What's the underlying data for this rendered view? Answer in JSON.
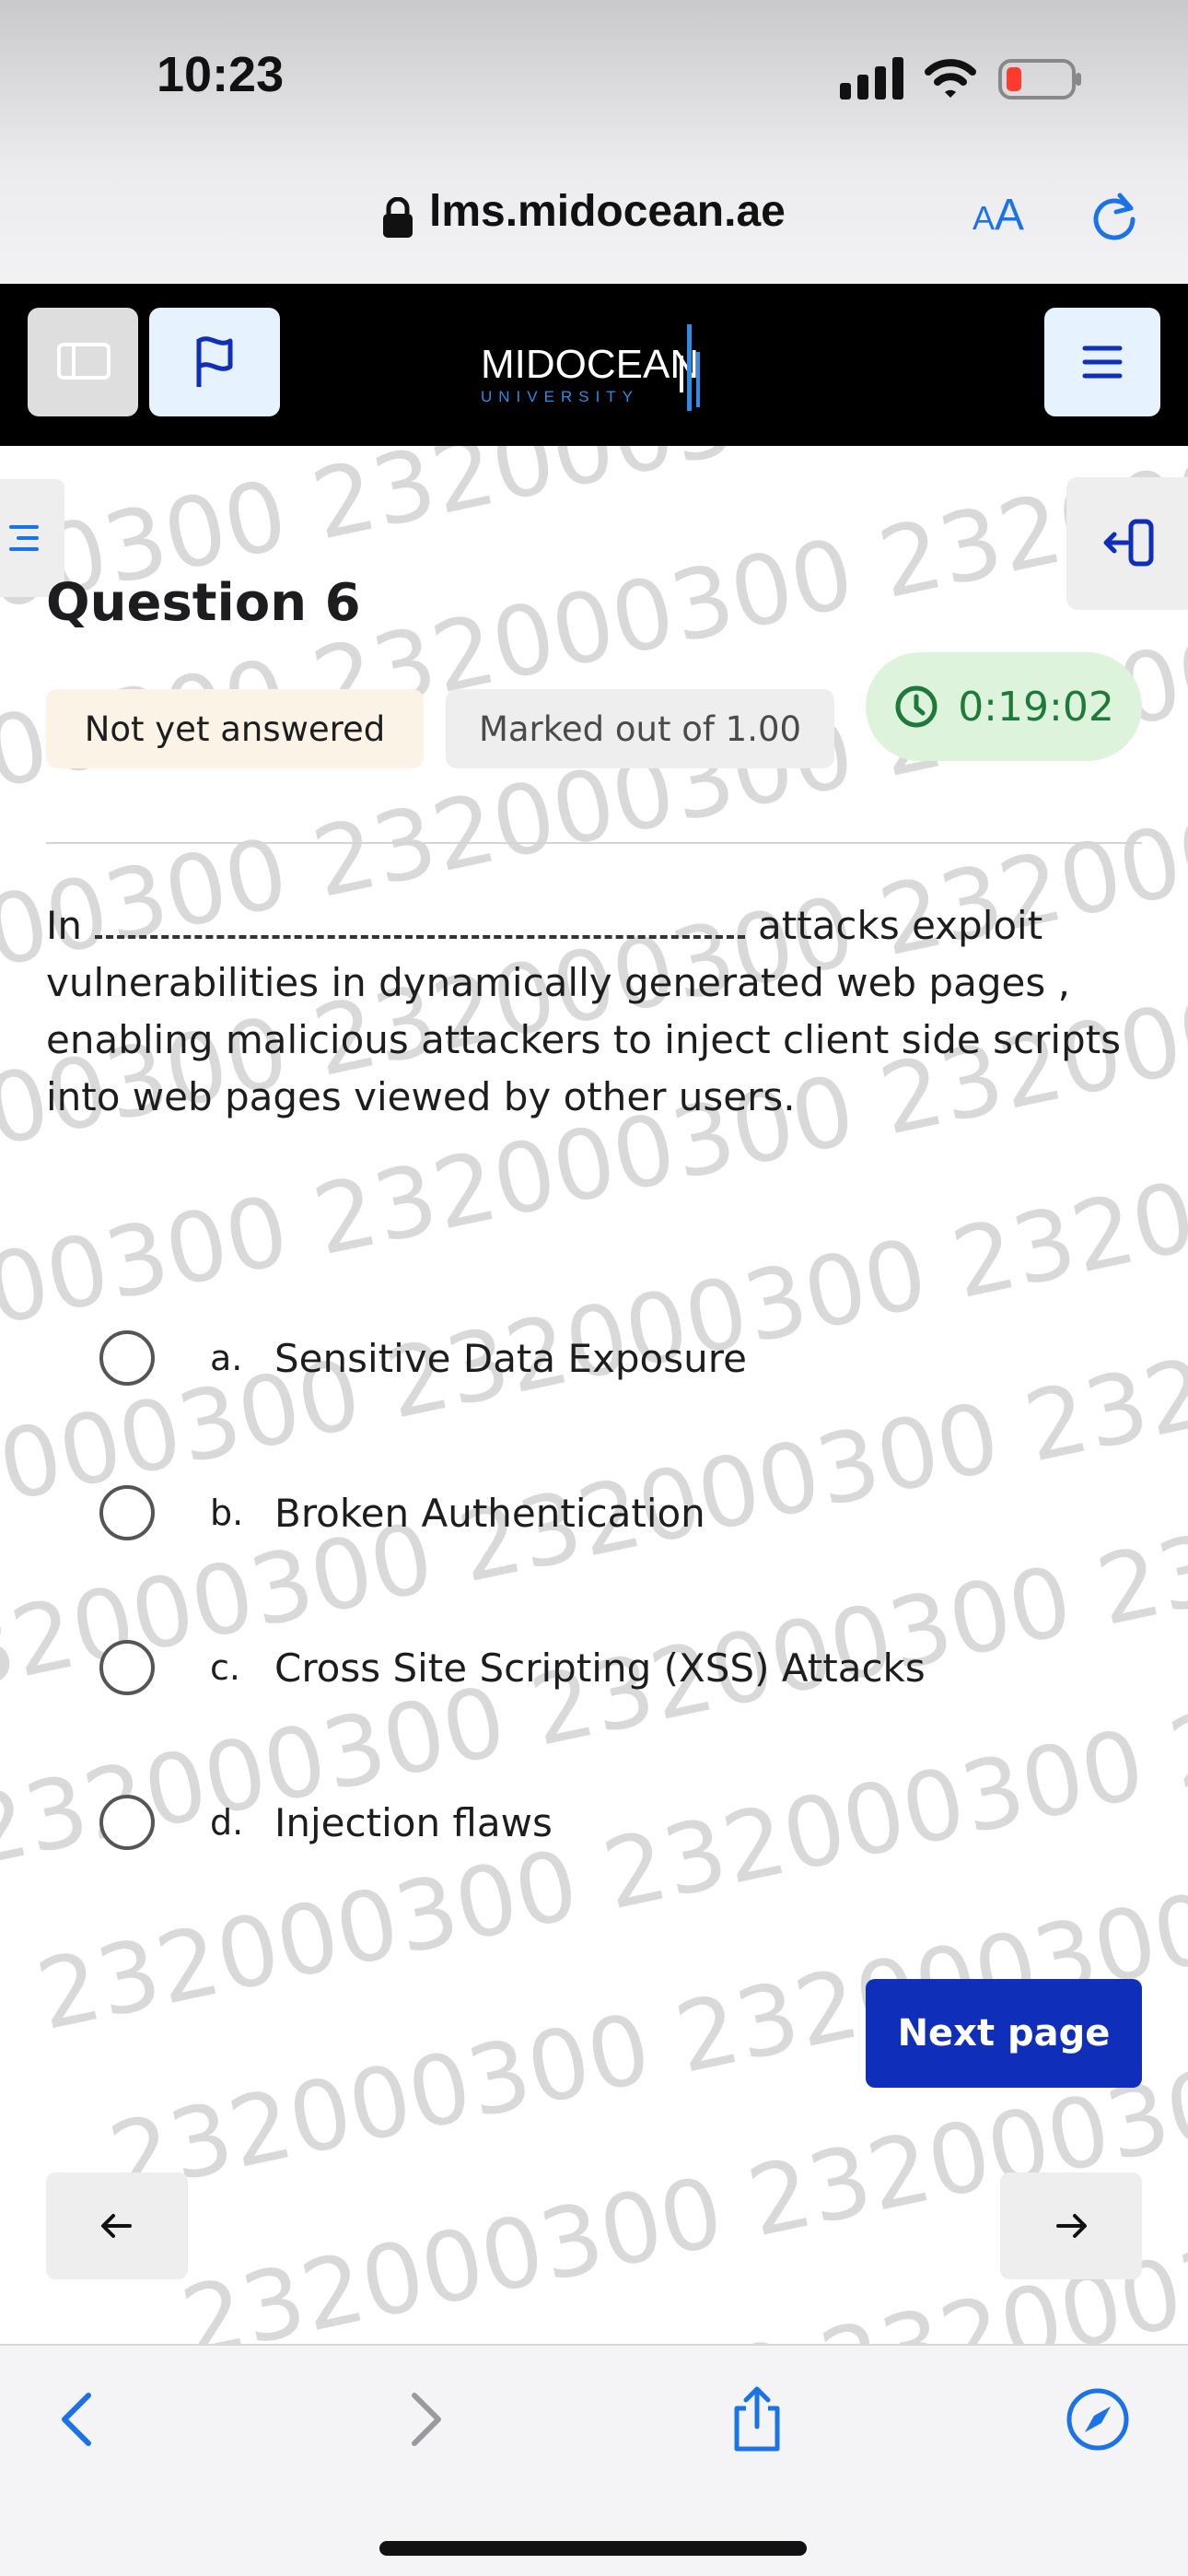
{
  "status_bar": {
    "time": "10:23"
  },
  "browser": {
    "url": "lms.midocean.ae",
    "text_size_label_small": "A",
    "text_size_label_large": "A"
  },
  "site": {
    "logo_main": "MIDOCEAN",
    "logo_sub": "UNIVERSITY"
  },
  "question": {
    "title": "Question 6",
    "status": "Not yet answered",
    "marks": "Marked out of 1.00",
    "timer": "0:19:02",
    "text_before": "In",
    "text_after": "attacks exploit vulnerabilities in dynamically generated web pages , enabling malicious attackers to inject client side scripts into web pages viewed by other users.",
    "options": [
      {
        "letter": "a.",
        "text": "Sensitive Data Exposure"
      },
      {
        "letter": "b.",
        "text": "Broken Authentication"
      },
      {
        "letter": "c.",
        "text": "Cross Site Scripting (XSS) Attacks"
      },
      {
        "letter": "d.",
        "text": "Injection flaws"
      }
    ]
  },
  "navigation": {
    "next_page": "Next page",
    "prev_arrow": "←",
    "next_arrow": "→"
  },
  "watermark_text": "232000300",
  "colors": {
    "primary": "#0f2fba",
    "timer_bg": "#ddf3dc",
    "timer_fg": "#1e7a39",
    "status_bg": "#fcf3e7",
    "ios_blue": "#1a73e8"
  },
  "icons": [
    "lock-icon",
    "reload-icon",
    "drawer-icon",
    "flag-icon",
    "hamburger-icon",
    "toc-icon",
    "exit-icon",
    "clock-icon",
    "back-icon",
    "forward-icon",
    "share-icon",
    "compass-icon"
  ]
}
